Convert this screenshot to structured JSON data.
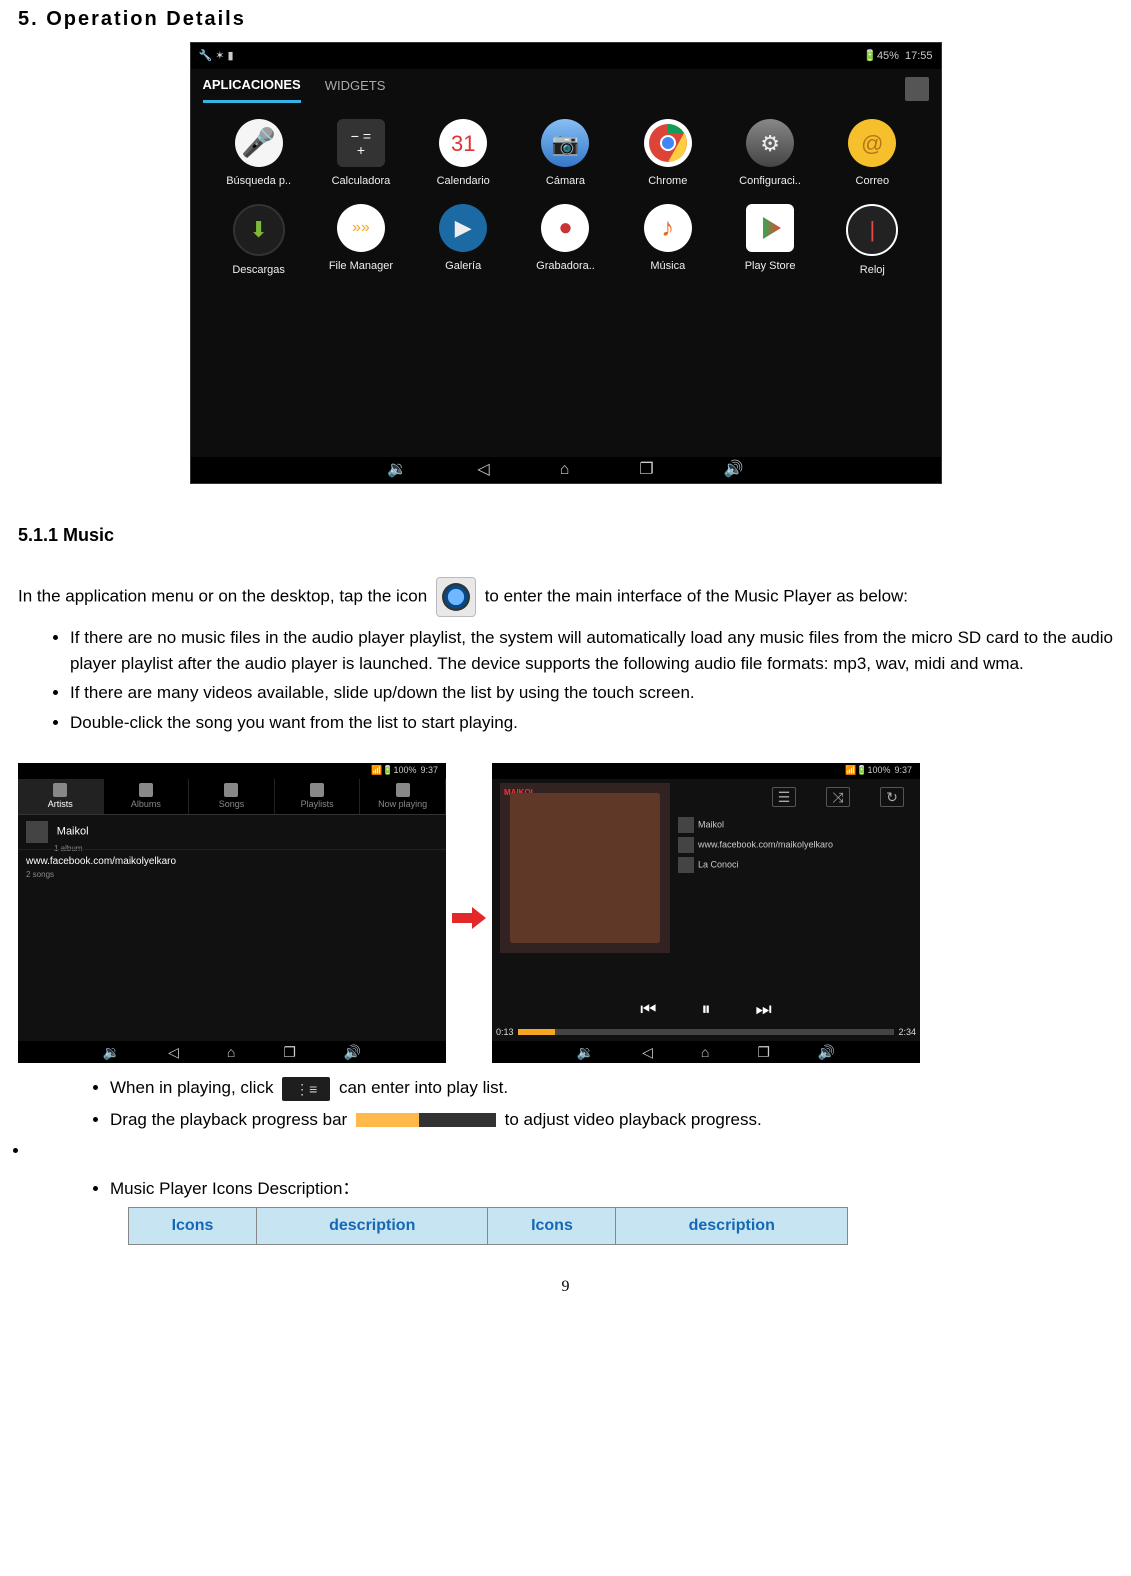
{
  "headings": {
    "section": "5. Operation Details",
    "subsection": "5.1.1 Music"
  },
  "tablet1": {
    "battery": "45%",
    "time": "17:55",
    "tab_apps": "APLICACIONES",
    "tab_widgets": "WIDGETS",
    "apps": [
      {
        "label": "Búsqueda p..",
        "icon": "search",
        "cls": "ic-search"
      },
      {
        "label": "Calculadora",
        "icon": "calc",
        "cls": "ic-calc"
      },
      {
        "label": "Calendario",
        "icon": "cal",
        "cls": "ic-cal"
      },
      {
        "label": "Cámara",
        "icon": "cam",
        "cls": "ic-cam"
      },
      {
        "label": "Chrome",
        "icon": "chrome",
        "cls": "ic-chrome"
      },
      {
        "label": "Configuraci..",
        "icon": "settings",
        "cls": "ic-settings"
      },
      {
        "label": "Correo",
        "icon": "mail",
        "cls": "ic-mail"
      },
      {
        "label": "Descargas",
        "icon": "download",
        "cls": "ic-download"
      },
      {
        "label": "File Manager",
        "icon": "file",
        "cls": "ic-file"
      },
      {
        "label": "Galería",
        "icon": "gallery",
        "cls": "ic-gallery"
      },
      {
        "label": "Grabadora..",
        "icon": "record",
        "cls": "ic-record"
      },
      {
        "label": "Música",
        "icon": "music",
        "cls": "ic-music"
      },
      {
        "label": "Play Store",
        "icon": "play",
        "cls": "ic-play"
      },
      {
        "label": "Reloj",
        "icon": "clock",
        "cls": "ic-clock"
      }
    ]
  },
  "paragraph_music_intro_before": "In the application menu or on the desktop, tap the icon",
  "paragraph_music_intro_after": "to enter the main interface of the Music Player as below:",
  "bullets_main": [
    "If there are no music files in the audio player playlist, the system will automatically load any music files from the micro SD card to the audio player playlist after the audio player is launched. The device supports the following audio file formats: mp3, wav, midi and wma.",
    "If there are many videos available, slide up/down the list by using the touch screen.",
    "Double-click the song you want from the list to start playing."
  ],
  "shots": {
    "status_battery": "100%",
    "status_time": "9:37",
    "tabs": [
      "Artists",
      "Albums",
      "Songs",
      "Playlists",
      "Now playing"
    ],
    "artist_name": "Maikol",
    "artist_sub": "1 album",
    "song_name": "www.facebook.com/maikolyelkaro",
    "song_sub": "2 songs",
    "album_label": "MAIKOL",
    "track_artist": "Maikol",
    "track_album": "www.facebook.com/maikolyelkaro",
    "track_title": "La Conoci",
    "time_current": "0:13",
    "time_total": "2:34"
  },
  "bullets_after": {
    "line1_before": "When in playing, click",
    "line1_after": "can enter into play list.",
    "line2_before": "Drag the playback progress bar",
    "line2_after": "to adjust video playback progress.",
    "line3": "Music Player Icons Description："
  },
  "icons_table": {
    "h_icons_a": "Icons",
    "h_desc_a": "description",
    "h_icons_b": "Icons",
    "h_desc_b": "description"
  },
  "page_number": "9"
}
